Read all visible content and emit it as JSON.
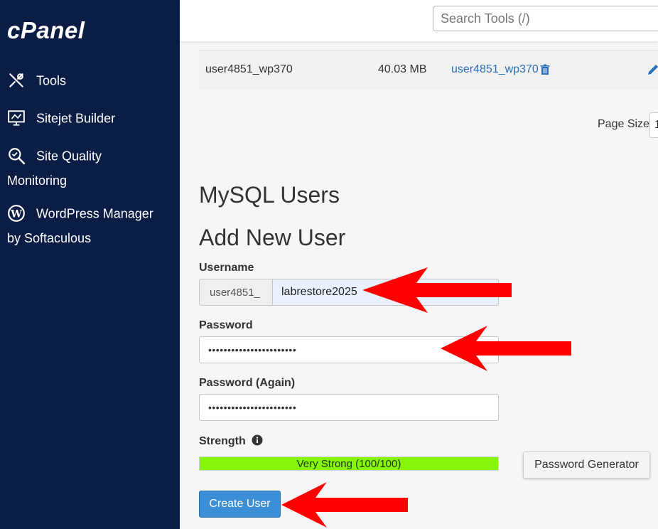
{
  "app": {
    "logo": "cPanel"
  },
  "sidebar": {
    "items": [
      {
        "label": "Tools",
        "icon": "tools-icon"
      },
      {
        "label": "Sitejet Builder",
        "icon": "sitejet-monitor-icon"
      },
      {
        "label": "Site Quality",
        "label2": "Monitoring",
        "icon": "magnifier-icon"
      },
      {
        "label": "WordPress Manager",
        "label2": "by Softaculous",
        "icon": "wordpress-icon"
      }
    ]
  },
  "search": {
    "placeholder": "Search Tools (/)"
  },
  "db_table": {
    "row": {
      "name": "user4851_wp370",
      "size": "40.03 MB",
      "user": "user4851_wp370"
    },
    "page_size_label": "Page Size",
    "page_size_value": "1"
  },
  "mysql_users": {
    "title": "MySQL Users",
    "add_title": "Add New User",
    "username_label": "Username",
    "username_prefix": "user4851_",
    "username_value": "labrestore2025",
    "password_label": "Password",
    "password_value": "•••••••••••••••••••••••",
    "password_again_label": "Password (Again)",
    "password_again_value": "•••••••••••••••••••••••",
    "strength_label": "Strength",
    "strength_text": "Very Strong (100/100)",
    "strength_score": 100,
    "strength_color": "#86f50c",
    "pw_generator_label": "Password Generator",
    "create_label": "Create User"
  },
  "colors": {
    "sidebar_bg": "#0b1d44",
    "accent_blue": "#3c8fd6",
    "link_blue": "#2a6fb8",
    "arrow_red": "#ff0000"
  }
}
